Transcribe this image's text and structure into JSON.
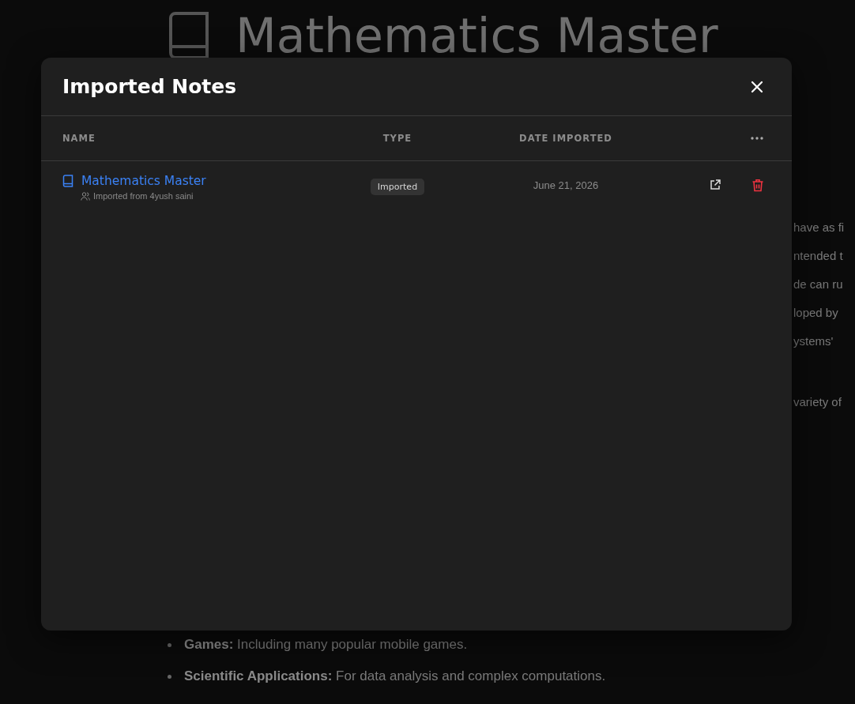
{
  "background": {
    "title": "Mathematics Master",
    "fragments": [
      "have as fi",
      "ntended t",
      "de can ru",
      "loped by",
      "ystems'",
      "variety of"
    ],
    "bullets": [
      "**Games:** Including many popular mobile games.",
      "**Scientific Applications:** For data analysis and complex computations."
    ]
  },
  "dialog": {
    "title": "Imported Notes",
    "columns": [
      "NAME",
      "TYPE",
      "DATE IMPORTED"
    ],
    "rows": [
      {
        "name": "Mathematics Master",
        "source": "Imported from 4yush saini",
        "type": "Imported",
        "date": "June 21, 2026"
      }
    ]
  }
}
